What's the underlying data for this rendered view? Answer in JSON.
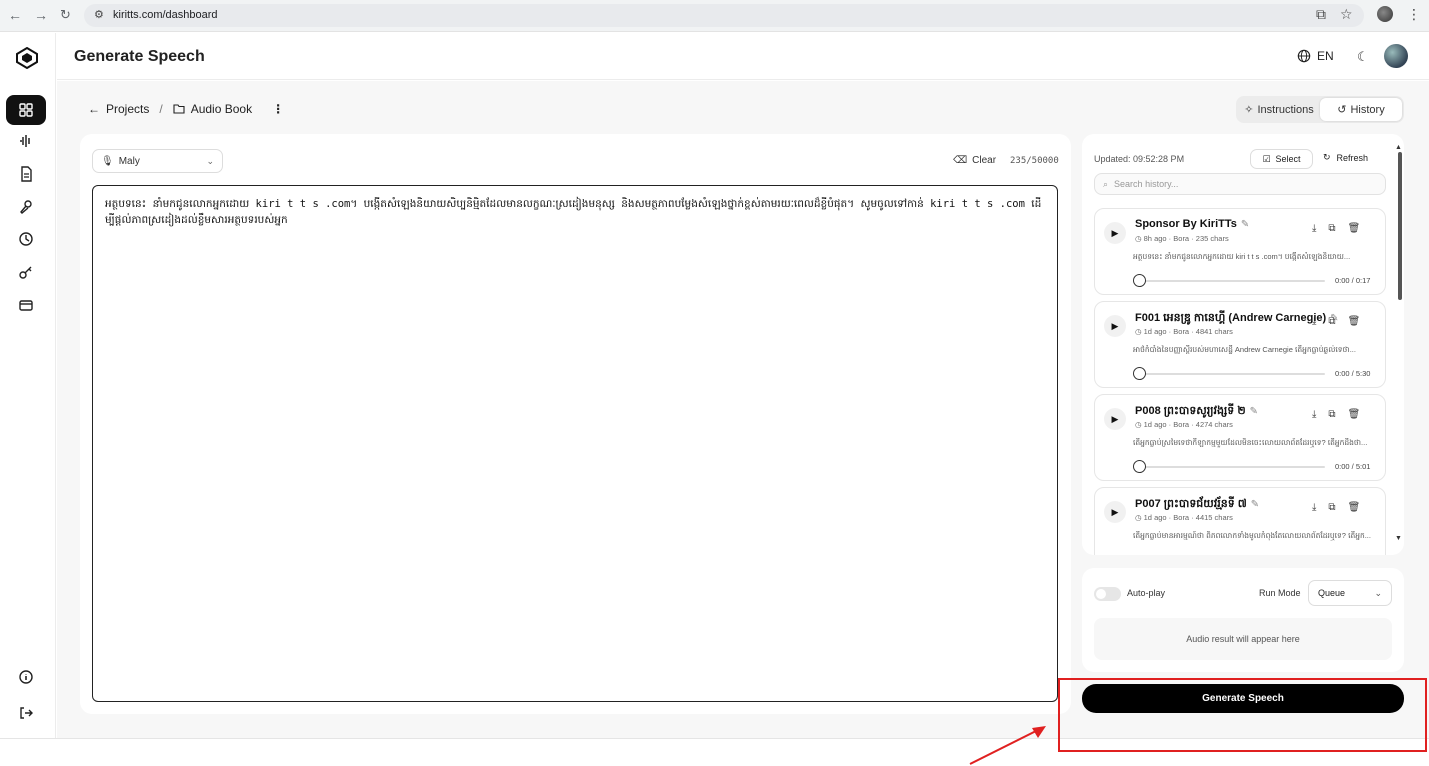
{
  "browser": {
    "url": "kiritts.com/dashboard"
  },
  "header": {
    "title": "Generate Speech",
    "language": "EN"
  },
  "breadcrumb": {
    "projects": "Projects",
    "separator": "/",
    "current": "Audio Book"
  },
  "tabs": {
    "instructions": "Instructions",
    "history": "History",
    "active": "history"
  },
  "editor": {
    "voice": "Maly",
    "clear_label": "Clear",
    "char_count": "235/50000",
    "text": "អត្ថបទនេះ នាំមកជូនលោកអ្នកដោយ kiri t t s .com។ បង្កើតសំឡេងនិយាយសិប្បនិម្មិតដែលមានលក្ខណៈស្រដៀងមនុស្ស និងសមត្ថភាពបម្លែងសំឡេងថ្នាក់ខ្ពស់តាមរយៈពេលដ៏ខ្លីបំផុត។ សូមចូលទៅកាន់ kiri t t s .com ដើម្បីផ្ដល់ភាពស្រដៀងដល់ខ្លឹមសារអត្ថបទរបស់អ្នក"
  },
  "history": {
    "updated": "Updated: 09:52:28 PM",
    "select_label": "Select",
    "refresh_label": "Refresh",
    "search_placeholder": "Search history...",
    "items": [
      {
        "title": "Sponsor By KiriTTs",
        "ago": "8h ago",
        "voice": "Bora",
        "chars": "235 chars",
        "preview": "អត្ថបទនេះ នាំមកជូនលោកអ្នកដោយ kiri t t s .com។ បង្កើតសំឡេងនិយាយ...",
        "time": "0:00 / 0:17"
      },
      {
        "title": "F001 អេនឌ្រូ កានេហ្គី (Andrew Carnegie)",
        "ago": "1d ago",
        "voice": "Bora",
        "chars": "4841 chars",
        "preview": "អាថ៌កំបាំងនៃបញ្ញាស្តីរបស់មហាសេដ្ឋី Andrew Carnegie តើអ្នកធ្លាប់ឆ្ងល់ទេថា...",
        "time": "0:00 / 5:30"
      },
      {
        "title": "P008 ព្រះបាទសូរ្យវង្សទី ២",
        "ago": "1d ago",
        "voice": "Bora",
        "chars": "4274 chars",
        "preview": "តើអ្នកធ្លាប់ស្រមៃទេថាកីឡាកម្មមួយដែលមិនចេះលោយលាព័តដែរឬទេ? តើអ្នកដឹងថា...",
        "time": "0:00 / 5:01"
      },
      {
        "title": "P007 ព្រះបាទជ័យវរ្ម័នទី ៧",
        "ago": "1d ago",
        "voice": "Bora",
        "chars": "4415 chars",
        "preview": "តើអ្នកធ្លាប់មានអារម្មណ៍ថា ពិភពលោកទាំងមូលកំពុងតែលោយលាព័តដែរឬទេ? តើអ្នក...",
        "time": ""
      }
    ]
  },
  "player": {
    "autoplay_label": "Auto-play",
    "autoplay_on": false,
    "run_mode_label": "Run Mode",
    "run_mode": "Queue",
    "placeholder": "Audio result will appear here"
  },
  "generate_label": "Generate Speech",
  "colors": {
    "annotation": "#e02020",
    "primary": "#000000"
  }
}
